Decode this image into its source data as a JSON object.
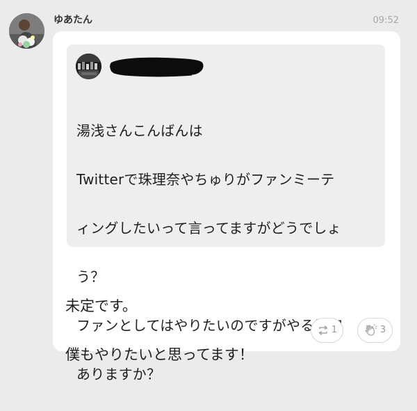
{
  "message": {
    "sender_name": "ゆあたん",
    "time": "09:52",
    "quoted": {
      "lines": [
        "湯浅さんこんばんは",
        "Twitterで珠理奈やちゅりがファンミーテ",
        "ィングしたいって言ってますがどうでしょ",
        "う？",
        "ファンとしてはやりたいのですがやる予定",
        "ありますか？"
      ]
    },
    "reply": {
      "lines": [
        "未定です。",
        "僕もやりたいと思ってます！"
      ]
    },
    "reactions": {
      "retweet_count": "1",
      "clap_count": "3"
    }
  },
  "icons": {
    "retweet": "retweet-icon",
    "clap": "clap-icon"
  },
  "colors": {
    "background": "#ebebeb",
    "card": "#ffffff",
    "quote_background": "#eeeeee",
    "timestamp": "#a7a7a7",
    "reaction_count": "#9a9a9a"
  }
}
